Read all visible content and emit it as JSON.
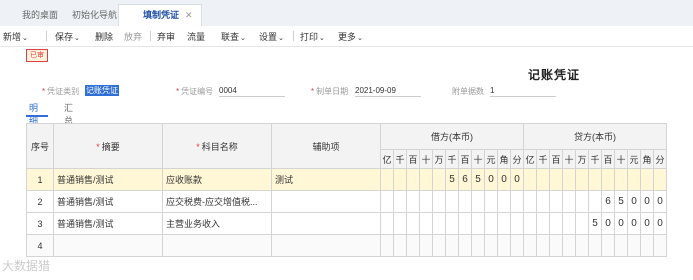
{
  "tabs": [
    {
      "label": "我的桌面"
    },
    {
      "label": "初始化导航"
    },
    {
      "label": "填制凭证",
      "close": "✕"
    }
  ],
  "toolbar": {
    "items": [
      {
        "label": "新增",
        "caret": "⌄"
      },
      {
        "label": "保存",
        "caret": "⌄"
      },
      {
        "label": "删除"
      },
      {
        "label": "放弃"
      },
      {
        "label": "弃审"
      },
      {
        "label": "流量"
      },
      {
        "label": "联查",
        "caret": "⌄"
      },
      {
        "label": "设置",
        "caret": "⌄"
      },
      {
        "label": "打印",
        "caret": "⌄"
      },
      {
        "label": "更多",
        "caret": "⌄"
      }
    ]
  },
  "status_stamp": "已审",
  "voucher": {
    "title": "记账凭证",
    "type_label": "凭证类别",
    "type_value": "记账凭证",
    "number_label": "凭证编号",
    "number_value": "0004",
    "date_label": "制单日期",
    "date_value": "2021-09-09",
    "attach_label": "附单据数",
    "attach_value": "1"
  },
  "subtabs": [
    {
      "label": "明细",
      "active": true
    },
    {
      "label": "汇总",
      "active": false
    }
  ],
  "grid": {
    "headers": {
      "seq": "序号",
      "summary": "摘要",
      "account": "科目名称",
      "aux": "辅助项",
      "debit": "借方(本币)",
      "credit": "贷方(本币)"
    },
    "digits": [
      "亿",
      "千",
      "百",
      "十",
      "万",
      "千",
      "百",
      "十",
      "元",
      "角",
      "分"
    ],
    "rows": [
      {
        "seq": "1",
        "summary": "普通销售/测试",
        "account": "应收账款",
        "aux": "测试",
        "debit": [
          "",
          "",
          "",
          "",
          "",
          "5",
          "6",
          "5",
          "0",
          "0",
          "0"
        ],
        "credit": [
          "",
          "",
          "",
          "",
          "",
          "",
          "",
          "",
          "",
          "",
          ""
        ],
        "highlight": true
      },
      {
        "seq": "2",
        "summary": "普通销售/测试",
        "account": "应交税费-应交增值税...",
        "aux": "",
        "debit": [
          "",
          "",
          "",
          "",
          "",
          "",
          "",
          "",
          "",
          "",
          ""
        ],
        "credit": [
          "",
          "",
          "",
          "",
          "",
          "",
          "6",
          "5",
          "0",
          "0",
          "0"
        ]
      },
      {
        "seq": "3",
        "summary": "普通销售/测试",
        "account": "主营业务收入",
        "aux": "",
        "debit": [
          "",
          "",
          "",
          "",
          "",
          "",
          "",
          "",
          "",
          "",
          ""
        ],
        "credit": [
          "",
          "",
          "",
          "",
          "",
          "5",
          "0",
          "0",
          "0",
          "0",
          "0"
        ]
      },
      {
        "seq": "4",
        "summary": "",
        "account": "",
        "aux": "",
        "debit": [
          "",
          "",
          "",
          "",
          "",
          "",
          "",
          "",
          "",
          "",
          ""
        ],
        "credit": [
          "",
          "",
          "",
          "",
          "",
          "",
          "",
          "",
          "",
          "",
          ""
        ],
        "empty": true
      }
    ]
  },
  "watermark": "大数据猎"
}
